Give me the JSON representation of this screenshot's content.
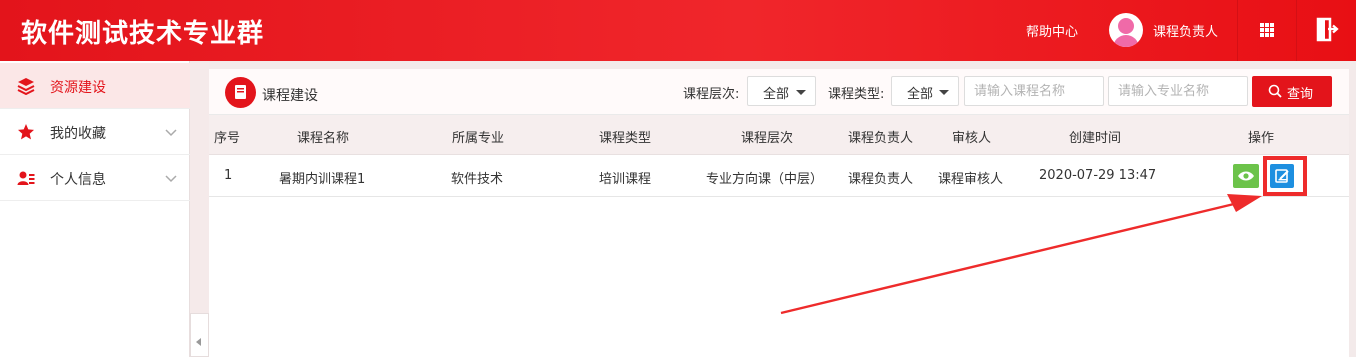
{
  "header": {
    "brand": "软件测试技术专业群",
    "help": "帮助中心",
    "user": "课程负责人"
  },
  "sidebar": {
    "items": [
      {
        "label": "资源建设",
        "icon": "layers-icon"
      },
      {
        "label": "我的收藏",
        "icon": "star-icon"
      },
      {
        "label": "个人信息",
        "icon": "user-card-icon"
      }
    ]
  },
  "panel": {
    "title": "课程建设",
    "filters": {
      "level_label": "课程层次:",
      "level_value": "全部",
      "type_label": "课程类型:",
      "type_value": "全部",
      "course_placeholder": "请输入课程名称",
      "major_placeholder": "请输入专业名称",
      "query_label": "查询"
    }
  },
  "table": {
    "headers": [
      "序号",
      "课程名称",
      "所属专业",
      "课程类型",
      "课程层次",
      "课程负责人",
      "审核人",
      "创建时间",
      "操作"
    ],
    "rows": [
      [
        "1",
        "暑期内训课程1",
        "软件技术",
        "培训课程",
        "专业方向课（中层）",
        "课程负责人",
        "课程审核人",
        "2020-07-29 13:47"
      ]
    ]
  },
  "colors": {
    "brand_red": "#e3141b",
    "view_green": "#6cc34a",
    "edit_blue": "#1d8fe0",
    "annotation_red": "#ee2b2b"
  }
}
